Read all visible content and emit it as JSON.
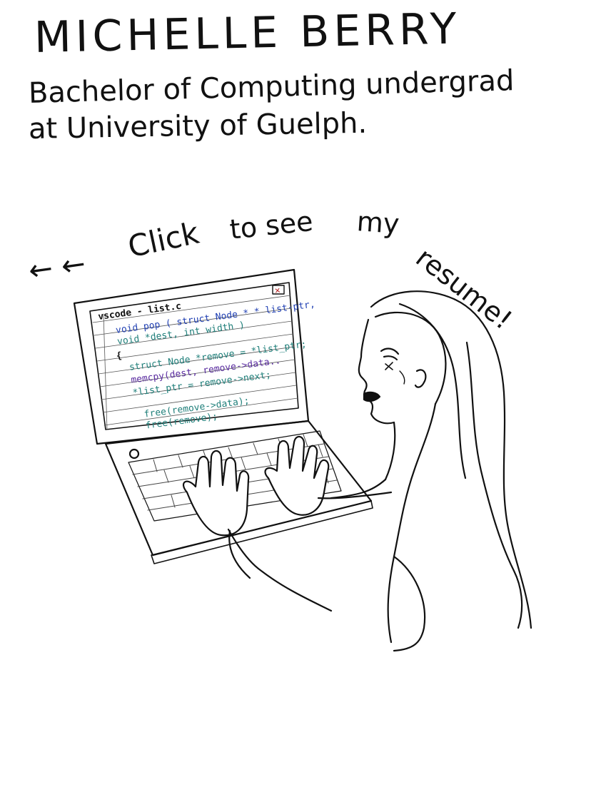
{
  "header": {
    "name": "MICHELLE BERRY",
    "subtitle_line1": "Bachelor of Computing undergrad",
    "subtitle_line2": "at University of Guelph."
  },
  "cta": {
    "arrows": "← ←",
    "word1": "Click",
    "word2": "to see",
    "word3": "my",
    "word4": "resume!"
  },
  "laptop": {
    "tab_title": "vscode - list.c",
    "close_glyph": "✕",
    "code": [
      "void pop ( struct Node * * list-ptr,",
      "      void *dest, int width )",
      "{",
      "struct Node *remove = *list_ptr;",
      "memcpy(dest, remove->data..",
      "*list_ptr = remove->next;",
      "",
      "free(remove->data);",
      "free(remove);"
    ],
    "colors": {
      "keyword": "#1f3fb3",
      "teal": "#1f7f7a",
      "red": "#b22222",
      "purple": "#5a2ca0",
      "ink": "#111111"
    }
  }
}
